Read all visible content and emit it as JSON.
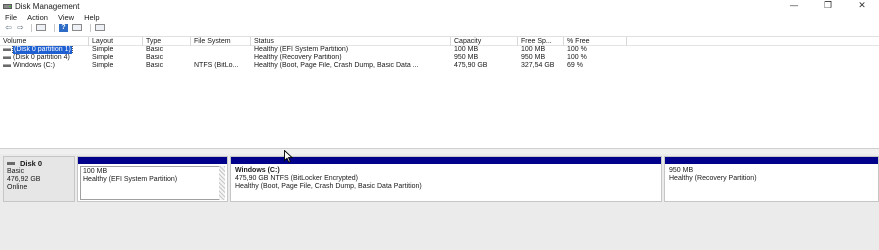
{
  "window": {
    "title": "Disk Management",
    "minimize_glyph": "—",
    "restore_glyph": "❐",
    "close_glyph": "✕"
  },
  "menu": [
    "File",
    "Action",
    "View",
    "Help"
  ],
  "toolbar": {
    "back_glyph": "⇦",
    "forward_glyph": "⇨",
    "help_glyph": "?"
  },
  "volume_table": {
    "columns": [
      "Volume",
      "Layout",
      "Type",
      "File System",
      "Status",
      "Capacity",
      "Free Sp...",
      "% Free"
    ],
    "rows": [
      {
        "volume": "(Disk 0 partition 1)",
        "layout": "Simple",
        "type": "Basic",
        "file_system": "",
        "status": "Healthy (EFI System Partition)",
        "capacity": "100 MB",
        "free_space": "100 MB",
        "pct_free": "100 %",
        "selected": true
      },
      {
        "volume": "(Disk 0 partition 4)",
        "layout": "Simple",
        "type": "Basic",
        "file_system": "",
        "status": "Healthy (Recovery Partition)",
        "capacity": "950 MB",
        "free_space": "950 MB",
        "pct_free": "100 %",
        "selected": false
      },
      {
        "volume": "Windows (C:)",
        "layout": "Simple",
        "type": "Basic",
        "file_system": "NTFS (BitLo...",
        "status": "Healthy (Boot, Page File, Crash Dump, Basic Data ...",
        "capacity": "475,90 GB",
        "free_space": "327,54 GB",
        "pct_free": "69 %",
        "selected": false
      }
    ]
  },
  "disk": {
    "name": "Disk 0",
    "type": "Basic",
    "size": "476,92 GB",
    "state": "Online",
    "partitions": [
      {
        "title": "",
        "size": "100 MB",
        "status": "Healthy (EFI System Partition)"
      },
      {
        "title": "Windows  (C:)",
        "size": "475,90 GB NTFS (BitLocker Encrypted)",
        "status": "Healthy (Boot, Page File, Crash Dump, Basic Data Partition)"
      },
      {
        "title": "",
        "size": "950 MB",
        "status": "Healthy (Recovery Partition)"
      }
    ]
  },
  "colors": {
    "partition_bar": "#00008b",
    "selection": "#1e5fd1"
  }
}
